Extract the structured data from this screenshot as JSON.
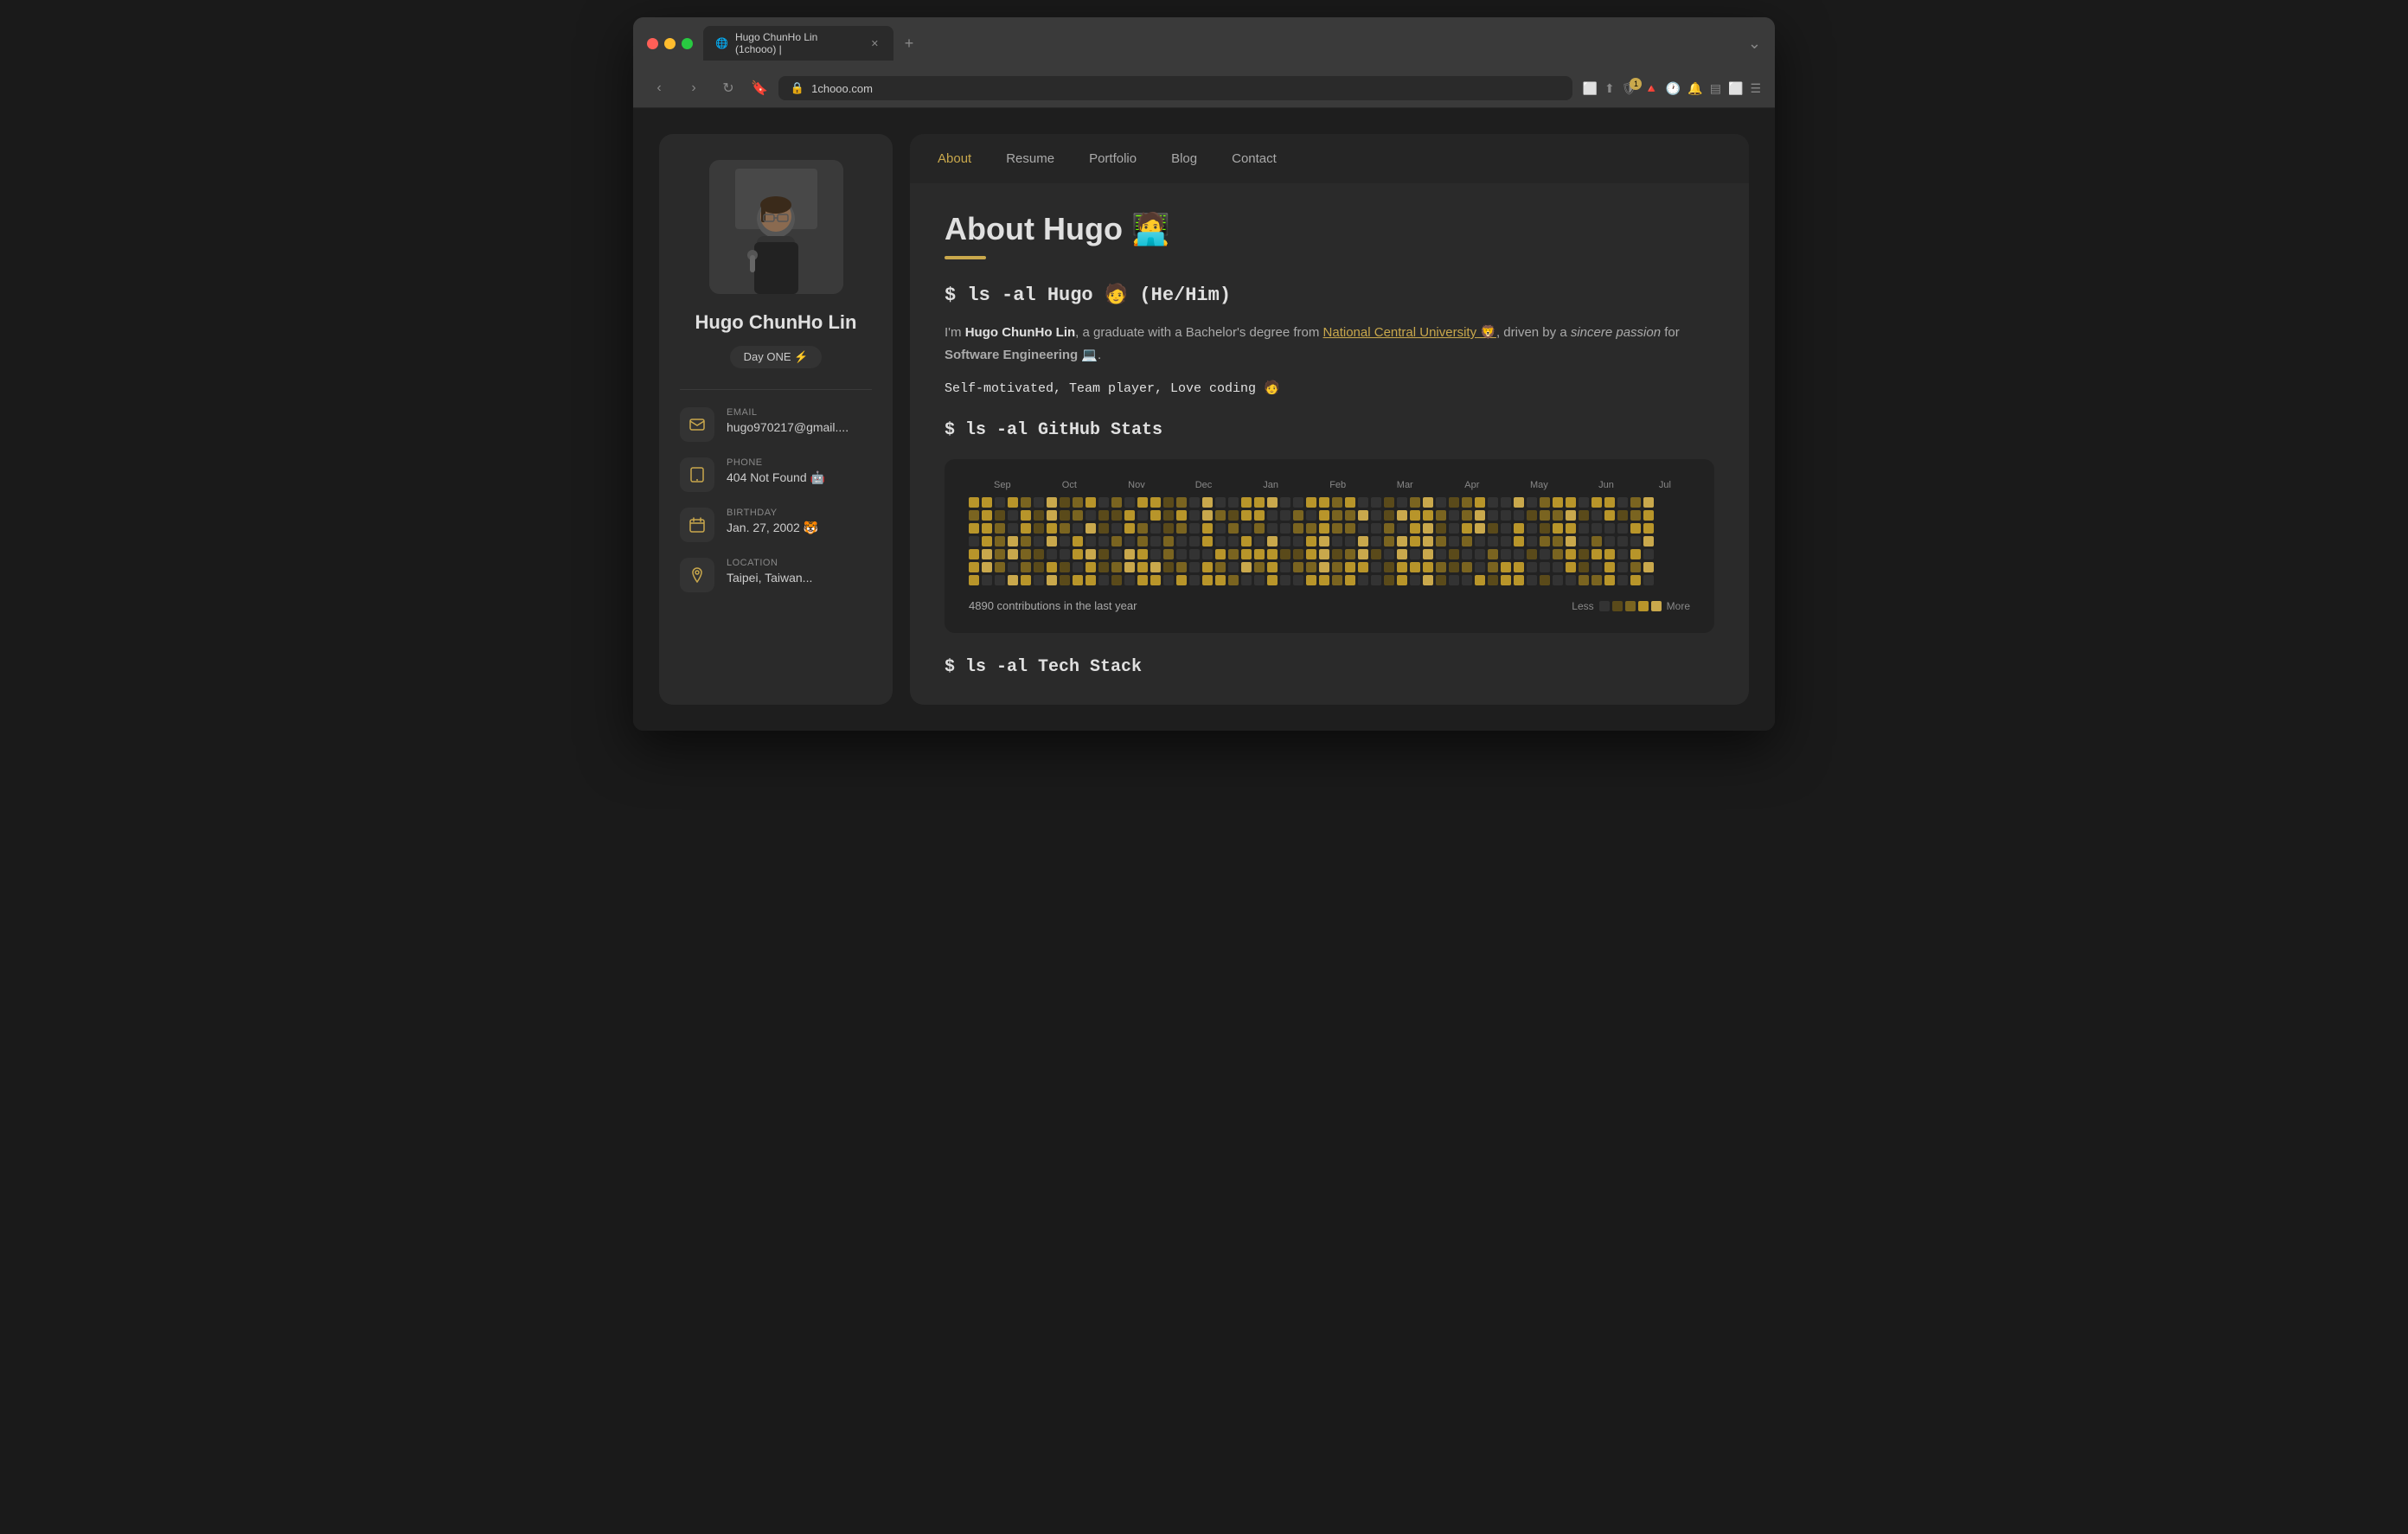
{
  "browser": {
    "tab_title": "Hugo ChunHo Lin (1chooo) |",
    "url": "1chooo.com",
    "new_tab_label": "+"
  },
  "sidebar": {
    "profile_name": "Hugo ChunHo Lin",
    "badge_label": "Day ONE ⚡",
    "contacts": [
      {
        "id": "email",
        "label": "EMAIL",
        "value": "hugo970217@gmail....",
        "icon": "✉"
      },
      {
        "id": "phone",
        "label": "PHONE",
        "value": "404 Not Found 🤖",
        "icon": "📞"
      },
      {
        "id": "birthday",
        "label": "BIRTHDAY",
        "value": "Jan. 27, 2002 🐯",
        "icon": "📅"
      },
      {
        "id": "location",
        "label": "LOCATION",
        "value": "...",
        "icon": "📍"
      }
    ]
  },
  "nav": {
    "items": [
      {
        "id": "about",
        "label": "About",
        "active": true
      },
      {
        "id": "resume",
        "label": "Resume",
        "active": false
      },
      {
        "id": "portfolio",
        "label": "Portfolio",
        "active": false
      },
      {
        "id": "blog",
        "label": "Blog",
        "active": false
      },
      {
        "id": "contact",
        "label": "Contact",
        "active": false
      }
    ]
  },
  "main": {
    "page_title": "About Hugo",
    "page_title_emoji": "🧑‍💻",
    "cmd_intro": "$ ls -al Hugo 🧑 (He/Him)",
    "about_text_1": "I'm ",
    "about_name": "Hugo ChunHo Lin",
    "about_text_2": ", a graduate with a Bachelor's degree from ",
    "about_university": "National Central University 🦁",
    "about_text_3": ", driven by a ",
    "about_italic": "sincere passion",
    "about_text_4": " for ",
    "about_bold_2": "Software Engineering 💻",
    "about_text_5": ".",
    "code_traits": "Self-motivated, Team player, Love coding 🧑",
    "cmd_github": "$ ls -al GitHub Stats",
    "contrib_count": "4890 contributions in the last year",
    "legend_less": "Less",
    "legend_more": "More",
    "months": [
      "Sep",
      "Oct",
      "Nov",
      "Dec",
      "Jan",
      "Feb",
      "Mar",
      "Apr",
      "May",
      "Jun",
      "Jul"
    ],
    "cmd_tech": "$ ls -al Tech Stack"
  },
  "colors": {
    "accent": "#c9a84c",
    "bg_dark": "#1e1e1e",
    "bg_card": "#2a2a2a",
    "text_primary": "#e0e0e0",
    "text_secondary": "#aaa"
  }
}
